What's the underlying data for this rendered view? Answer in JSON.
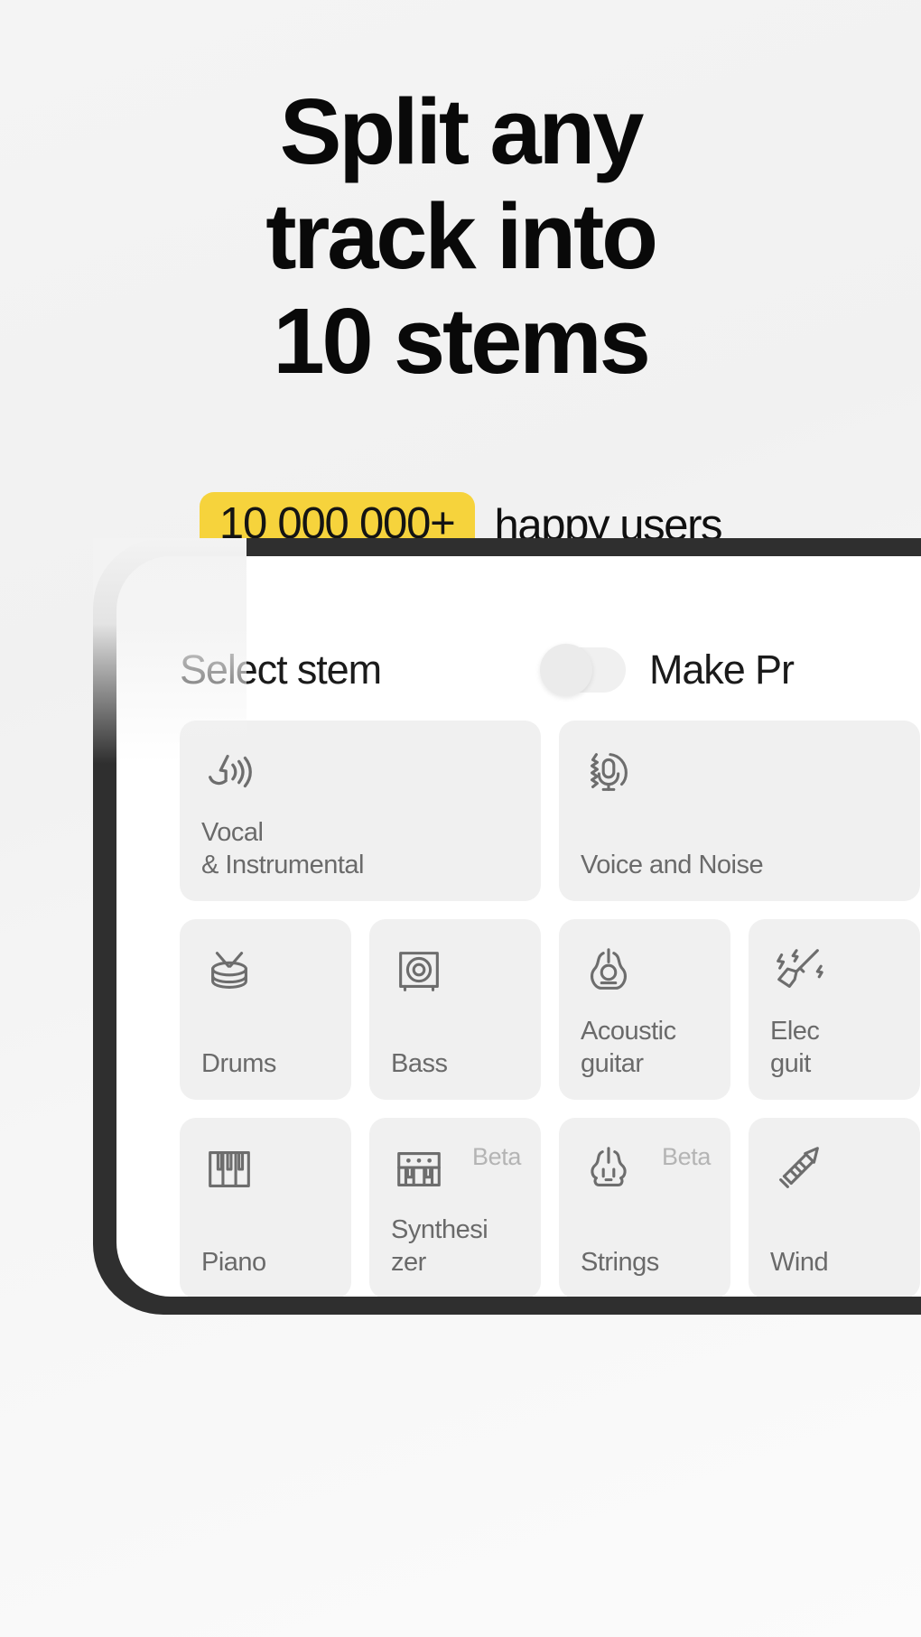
{
  "hero": {
    "title": "Split any\ntrack into\n10 stems",
    "count_badge": "10 000 000+",
    "happy_users": "happy users"
  },
  "panel": {
    "title": "Select stem",
    "make_pro_label": "Make Pr",
    "toggle": {
      "name": "make-pro-toggle",
      "state": "off"
    },
    "rows": [
      {
        "tiles": [
          {
            "label": "Vocal\n& Instrumental",
            "icon": "vocal-instrumental-icon",
            "size": "wide",
            "beta": ""
          },
          {
            "label": "Voice and Noise",
            "icon": "voice-noise-icon",
            "size": "wide",
            "beta": ""
          }
        ]
      },
      {
        "tiles": [
          {
            "label": "Drums",
            "icon": "drums-icon",
            "size": "narrow",
            "beta": ""
          },
          {
            "label": "Bass",
            "icon": "bass-icon",
            "size": "narrow",
            "beta": ""
          },
          {
            "label": "Acoustic\nguitar",
            "icon": "acoustic-guitar-icon",
            "size": "narrow",
            "beta": ""
          },
          {
            "label": "Elec\nguit",
            "icon": "electric-guitar-icon",
            "size": "narrow",
            "beta": ""
          }
        ]
      },
      {
        "tiles": [
          {
            "label": "Piano",
            "icon": "piano-icon",
            "size": "narrow",
            "beta": ""
          },
          {
            "label": "Synthesi\nzer",
            "icon": "synthesizer-icon",
            "size": "narrow",
            "beta": "Beta"
          },
          {
            "label": "Strings",
            "icon": "strings-icon",
            "size": "narrow",
            "beta": "Beta"
          },
          {
            "label": "Wind",
            "icon": "winds-icon",
            "size": "narrow",
            "beta": ""
          }
        ]
      }
    ]
  },
  "colors": {
    "accent_yellow": "#f6d33c",
    "background": "#f3f3f3",
    "tile_bg": "#f0f0f0",
    "text_dark": "#101010",
    "text_muted": "#6a6a6a",
    "bezel": "#2f2f2f"
  }
}
